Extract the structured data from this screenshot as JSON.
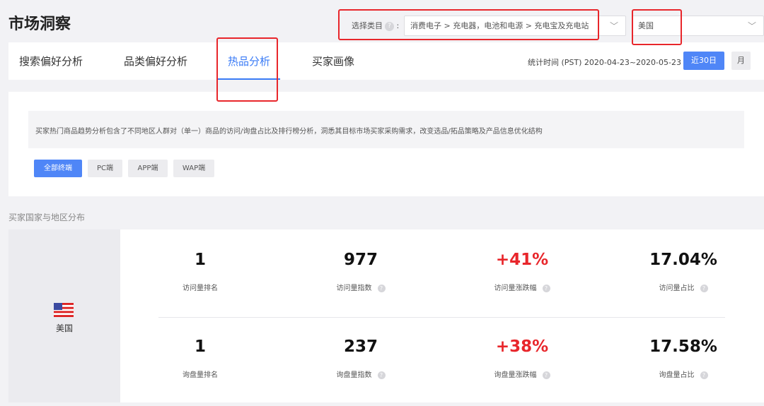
{
  "header": {
    "title": "市场洞察",
    "category_label": "选择类目",
    "help_icon": "?",
    "category_value": "消费电子 > 充电器，电池和电源 > 充电宝及充电站",
    "country_value": "美国"
  },
  "tabs": [
    {
      "label": "搜索偏好分析"
    },
    {
      "label": "品类偏好分析"
    },
    {
      "label": "热品分析"
    },
    {
      "label": "买家画像"
    }
  ],
  "date": {
    "text": "统计时间 (PST) 2020-04-23~2020-05-23",
    "btn_30d": "近30日",
    "btn_month": "月"
  },
  "info": {
    "description": "买家热门商品趋势分析包含了不同地区人群对（单一）商品的访问/询盘占比及排行榜分析，洞悉其目标市场买家采购需求，改变选品/拓品策略及产品信息优化结构",
    "terminals": [
      "全部终端",
      "PC端",
      "APP端",
      "WAP端"
    ]
  },
  "distribution": {
    "title": "买家国家与地区分布",
    "country": "美国",
    "visits": [
      {
        "value": "1",
        "label": "访问量排名"
      },
      {
        "value": "977",
        "label": "访问量指数"
      },
      {
        "value": "+41%",
        "label": "访问量涨跌幅"
      },
      {
        "value": "17.04%",
        "label": "访问量占比"
      }
    ],
    "inquiries": [
      {
        "value": "1",
        "label": "询盘量排名"
      },
      {
        "value": "237",
        "label": "询盘量指数"
      },
      {
        "value": "+38%",
        "label": "询盘量涨跌幅"
      },
      {
        "value": "17.58%",
        "label": "询盘量占比"
      }
    ]
  },
  "colors": {
    "accent": "#3a7bf6",
    "highlight": "#e8262b"
  }
}
